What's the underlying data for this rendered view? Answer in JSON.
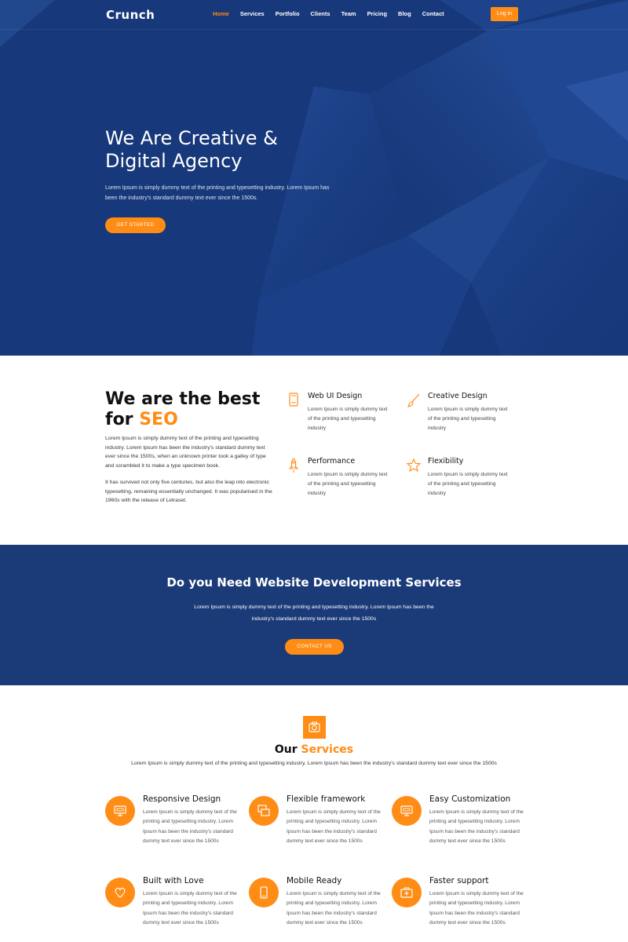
{
  "brand": {
    "name": "Crunch",
    "accent_color": "#ff8c14",
    "hero_color": "#17387a",
    "band_color": "#1b3b78"
  },
  "nav": {
    "items": [
      {
        "label": "Home",
        "active": true
      },
      {
        "label": "Services",
        "active": false
      },
      {
        "label": "Portfolio",
        "active": false
      },
      {
        "label": "Clients",
        "active": false
      },
      {
        "label": "Team",
        "active": false
      },
      {
        "label": "Pricing",
        "active": false
      },
      {
        "label": "Blog",
        "active": false
      },
      {
        "label": "Contact",
        "active": false
      }
    ],
    "login_label": "Log in"
  },
  "hero": {
    "title_line1": "We Are Creative &",
    "title_line2": "Digital Agency",
    "text": "Lorem Ipsum is simply dummy text of the printing and typesetting industry. Lorem Ipsum has been the industry's standard dummy text ever since the 1500s.",
    "button_label": "GET STARTED"
  },
  "seo": {
    "title_line1": "We are the best",
    "title_prefix": "for ",
    "title_accent": "SEO",
    "paragraph1": "Lorem Ipsum is simply dummy text of the printing and typesetting industry. Lorem Ipsum has been the industry's standard dummy text ever since the 1500s, when an unknown printer took a galley of type and scrambled it to make a type specimen book.",
    "paragraph2": "It has survived not only five centuries, but also the leap into electronic typesetting, remaining essentially unchanged. It was popularised in the 1960s with the release of Letraset.",
    "features": [
      {
        "icon": "mobile-icon",
        "title": "Web UI Design",
        "text": "Lorem Ipsum is simply dummy text of the printing and typesetting industry"
      },
      {
        "icon": "brush-icon",
        "title": "Creative Design",
        "text": "Lorem Ipsum is simply dummy text of the printing and typesetting industry"
      },
      {
        "icon": "rocket-icon",
        "title": "Performance",
        "text": "Lorem Ipsum is simply dummy text of the printing and typesetting industry"
      },
      {
        "icon": "star-icon",
        "title": "Flexibility",
        "text": "Lorem Ipsum is simply dummy text of the printing and typesetting industry"
      }
    ]
  },
  "cta": {
    "title": "Do you Need Website Development Services",
    "text": "Lorem Ipsum is simply dummy text of the printing and typesetting industry. Lorem Ipsum has been the industry's standard dummy text ever since the 1500s",
    "button_label": "CONTACT US"
  },
  "services": {
    "badge_icon": "camera-icon",
    "heading_prefix": "Our ",
    "heading_accent": "Services",
    "subtitle": "Lorem Ipsum is simply dummy text of the printing and typesetting industry. Lorem Ipsum has been the industry's standard dummy text ever since the 1500s",
    "items": [
      {
        "icon": "monitor-icon",
        "title": "Responsive Design",
        "text": "Lorem Ipsum is simply dummy text of the printing and typesetting industry. Lorem Ipsum has been the industry's standard dummy text ever since the 1500s"
      },
      {
        "icon": "layers-icon",
        "title": "Flexible framework",
        "text": "Lorem Ipsum is simply dummy text of the printing and typesetting industry. Lorem Ipsum has been the industry's standard dummy text ever since the 1500s"
      },
      {
        "icon": "monitor-icon",
        "title": "Easy Customization",
        "text": "Lorem Ipsum is simply dummy text of the printing and typesetting industry. Lorem Ipsum has been the industry's standard dummy text ever since the 1500s"
      },
      {
        "icon": "heart-icon",
        "title": "Built with Love",
        "text": "Lorem Ipsum is simply dummy text of the printing and typesetting industry. Lorem Ipsum has been the industry's standard dummy text ever since the 1500s"
      },
      {
        "icon": "mobile-icon",
        "title": "Mobile Ready",
        "text": "Lorem Ipsum is simply dummy text of the printing and typesetting industry. Lorem Ipsum has been the industry's standard dummy text ever since the 1500s"
      },
      {
        "icon": "medkit-icon",
        "title": "Faster support",
        "text": "Lorem Ipsum is simply dummy text of the printing and typesetting industry. Lorem Ipsum has been the industry's standard dummy text ever since the 1500s"
      }
    ]
  }
}
